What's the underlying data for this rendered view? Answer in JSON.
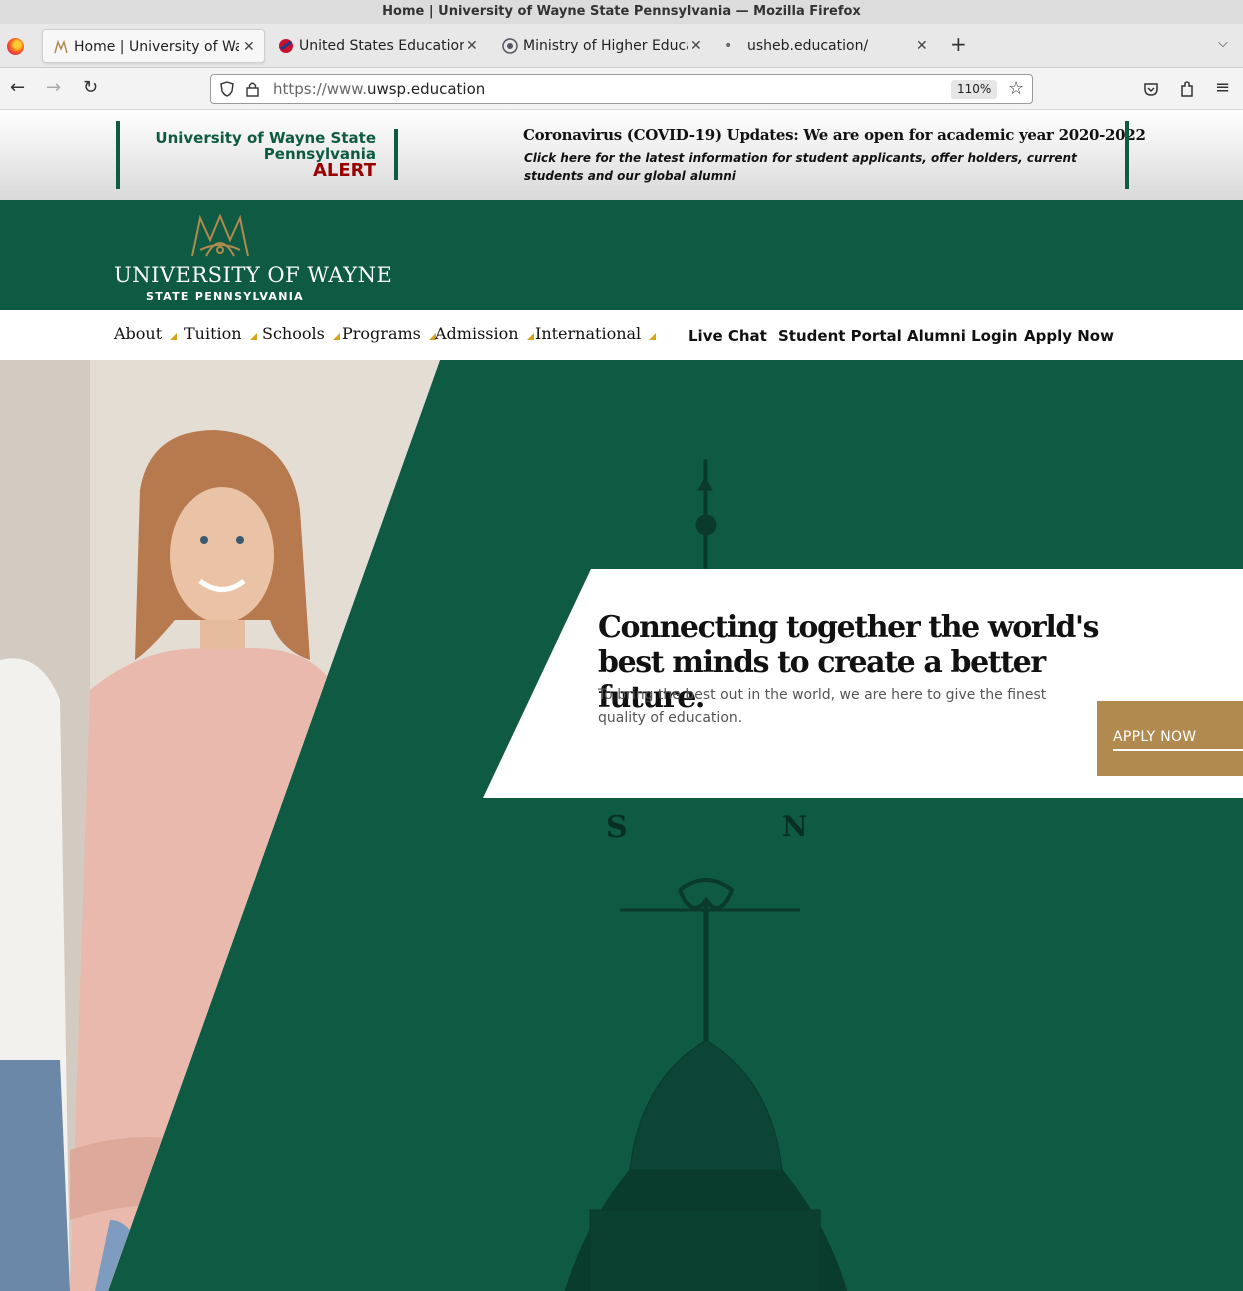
{
  "window": {
    "title": "Home | University of Wayne State Pennsylvania — Mozilla Firefox"
  },
  "tabs": [
    {
      "label": "Home | University of Wayne State Pennsylvania",
      "active": true
    },
    {
      "label": "United States Education Information Center"
    },
    {
      "label": "Ministry of Higher Education"
    },
    {
      "label": "usheb.education/"
    }
  ],
  "address_bar": {
    "url_prefix": "https://www.",
    "url_domain": "uwsp.education",
    "zoom": "110%"
  },
  "alert": {
    "university_line1": "University of Wayne State",
    "university_line2": "Pennsylvania",
    "label": "ALERT",
    "headline": "Coronavirus (COVID-19) Updates: We are open for academic year 2020-2022",
    "subtext": "Click here for the latest information for student applicants, offer holders, current students and our global alumni"
  },
  "logo": {
    "name": "UNIVERSITY OF WAYNE",
    "sub": "STATE PENNSYLVANIA"
  },
  "menu": {
    "items": [
      "About",
      "Tuition",
      "Schools",
      "Programs",
      "Admission",
      "International"
    ],
    "links": [
      "Live Chat",
      "Student Portal",
      "Alumni Login",
      "Apply Now"
    ]
  },
  "hero": {
    "title": "Connecting together the world's best minds to create a better future.",
    "text": "To bring the best out in the world, we are here to give the finest quality of education.",
    "cta": "APPLY NOW",
    "weathervane_south": "S",
    "weathervane_north": "N"
  },
  "colors": {
    "brand_green": "#0e5a42",
    "accent_gold": "#b08a4e",
    "alert_red": "#9a0000",
    "caret_yellow": "#d8a31a"
  }
}
